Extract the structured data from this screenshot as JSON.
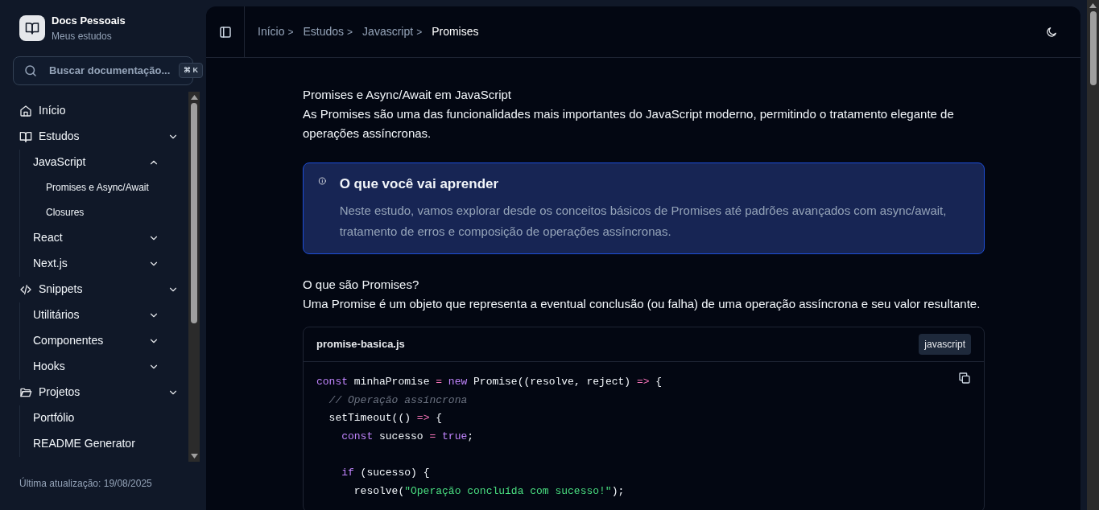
{
  "brand": {
    "title": "Docs Pessoais",
    "subtitle": "Meus estudos"
  },
  "search": {
    "placeholder": "Buscar documentação...",
    "shortcut": "⌘ K"
  },
  "sidebar": {
    "items": [
      {
        "label": "Início"
      },
      {
        "label": "Estudos",
        "expanded": false,
        "children": [
          {
            "label": "JavaScript",
            "expanded": true,
            "children": [
              {
                "label": "Promises e Async/Await"
              },
              {
                "label": "Closures"
              }
            ]
          },
          {
            "label": "React",
            "expanded": false
          },
          {
            "label": "Next.js",
            "expanded": false
          }
        ]
      },
      {
        "label": "Snippets",
        "expanded": false,
        "children": [
          {
            "label": "Utilitários",
            "expanded": false
          },
          {
            "label": "Componentes",
            "expanded": false
          },
          {
            "label": "Hooks",
            "expanded": false
          }
        ]
      },
      {
        "label": "Projetos",
        "expanded": false,
        "children": [
          {
            "label": "Portfólio"
          },
          {
            "label": "README Generator"
          }
        ]
      }
    ]
  },
  "footer": "Última atualização: 19/08/2025",
  "breadcrumb": [
    {
      "label": "Início",
      "current": false
    },
    {
      "label": "Estudos",
      "current": false
    },
    {
      "label": "Javascript",
      "current": false
    },
    {
      "label": "Promises",
      "current": true
    }
  ],
  "breadcrumb_separator": ">",
  "article": {
    "title": "Promises e Async/Await em JavaScript",
    "intro": "As Promises são uma das funcionalidades mais importantes do JavaScript moderno, permitindo o tratamento elegante de operações assíncronas.",
    "callout": {
      "title": "O que você vai aprender",
      "text": "Neste estudo, vamos explorar desde os conceitos básicos de Promises até padrões avançados com async/await, tratamento de erros e composição de operações assíncronas."
    },
    "section_title": "O que são Promises?",
    "section_text": "Uma Promise é um objeto que representa a eventual conclusão (ou falha) de uma operação assíncrona e seu valor resultante.",
    "code": {
      "filename": "promise-basica.js",
      "language": "javascript",
      "lines": [
        {
          "tokens": [
            {
              "kind": "keyword",
              "text": "const"
            },
            {
              "kind": "plain",
              "text": " minhaPromise "
            },
            {
              "kind": "operator",
              "text": "="
            },
            {
              "kind": "keyword",
              "text": " new"
            },
            {
              "kind": "plain",
              "text": " Promise((resolve, reject) "
            },
            {
              "kind": "operator",
              "text": "=>"
            },
            {
              "kind": "plain",
              "text": " {"
            }
          ]
        },
        {
          "tokens": [
            {
              "kind": "comment",
              "text": "  // Operação assíncrona"
            }
          ]
        },
        {
          "tokens": [
            {
              "kind": "plain",
              "text": "  setTimeout(() "
            },
            {
              "kind": "operator",
              "text": "=>"
            },
            {
              "kind": "plain",
              "text": " {"
            }
          ]
        },
        {
          "tokens": [
            {
              "kind": "keyword",
              "text": "    const"
            },
            {
              "kind": "plain",
              "text": " sucesso "
            },
            {
              "kind": "operator",
              "text": "="
            },
            {
              "kind": "keyword",
              "text": " true"
            },
            {
              "kind": "plain",
              "text": ";"
            }
          ]
        },
        {
          "gap_before": true,
          "tokens": [
            {
              "kind": "keyword",
              "text": "    if"
            },
            {
              "kind": "plain",
              "text": " (sucesso) {"
            }
          ]
        },
        {
          "tokens": [
            {
              "kind": "plain",
              "text": "      resolve("
            },
            {
              "kind": "string",
              "text": "\"Operação concluída com sucesso!\""
            },
            {
              "kind": "plain",
              "text": ");"
            }
          ]
        }
      ]
    }
  }
}
